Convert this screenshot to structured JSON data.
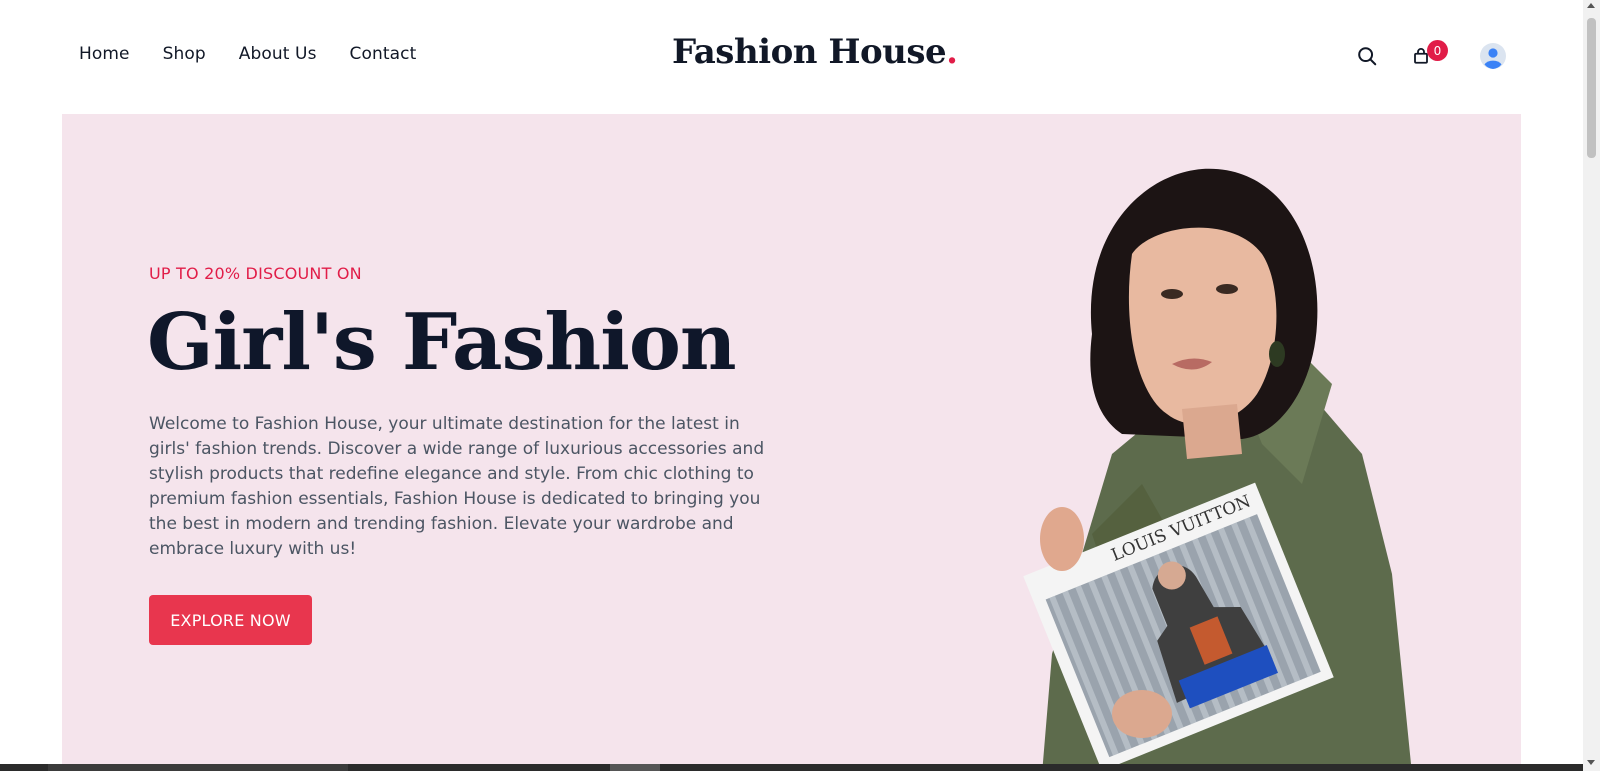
{
  "nav": {
    "items": [
      {
        "label": "Home"
      },
      {
        "label": "Shop"
      },
      {
        "label": "About Us"
      },
      {
        "label": "Contact"
      }
    ]
  },
  "logo": {
    "text": "Fashion House",
    "dot": "."
  },
  "header_icons": {
    "search": "search-icon",
    "cart": "shopping-bag-icon",
    "cart_count": "0",
    "user": "user-avatar-icon"
  },
  "hero": {
    "eyebrow": "UP TO 20% DISCOUNT ON",
    "title": "Girl's Fashion",
    "description": "Welcome to Fashion House, your ultimate destination for the latest in girls' fashion trends. Discover a wide range of luxurious accessories and stylish products that redefine elegance and style. From chic clothing to premium fashion essentials, Fashion House is dedicated to bringing you the best in modern and trending fashion. Elevate your wardrobe and embrace luxury with us!",
    "cta_label": "EXPLORE NOW",
    "magazine_text": "LOUIS VUITTON"
  },
  "colors": {
    "accent": "#e11d48",
    "hero_bg": "#f5e4ec",
    "button": "#e8364e",
    "heading": "#0f172a"
  }
}
